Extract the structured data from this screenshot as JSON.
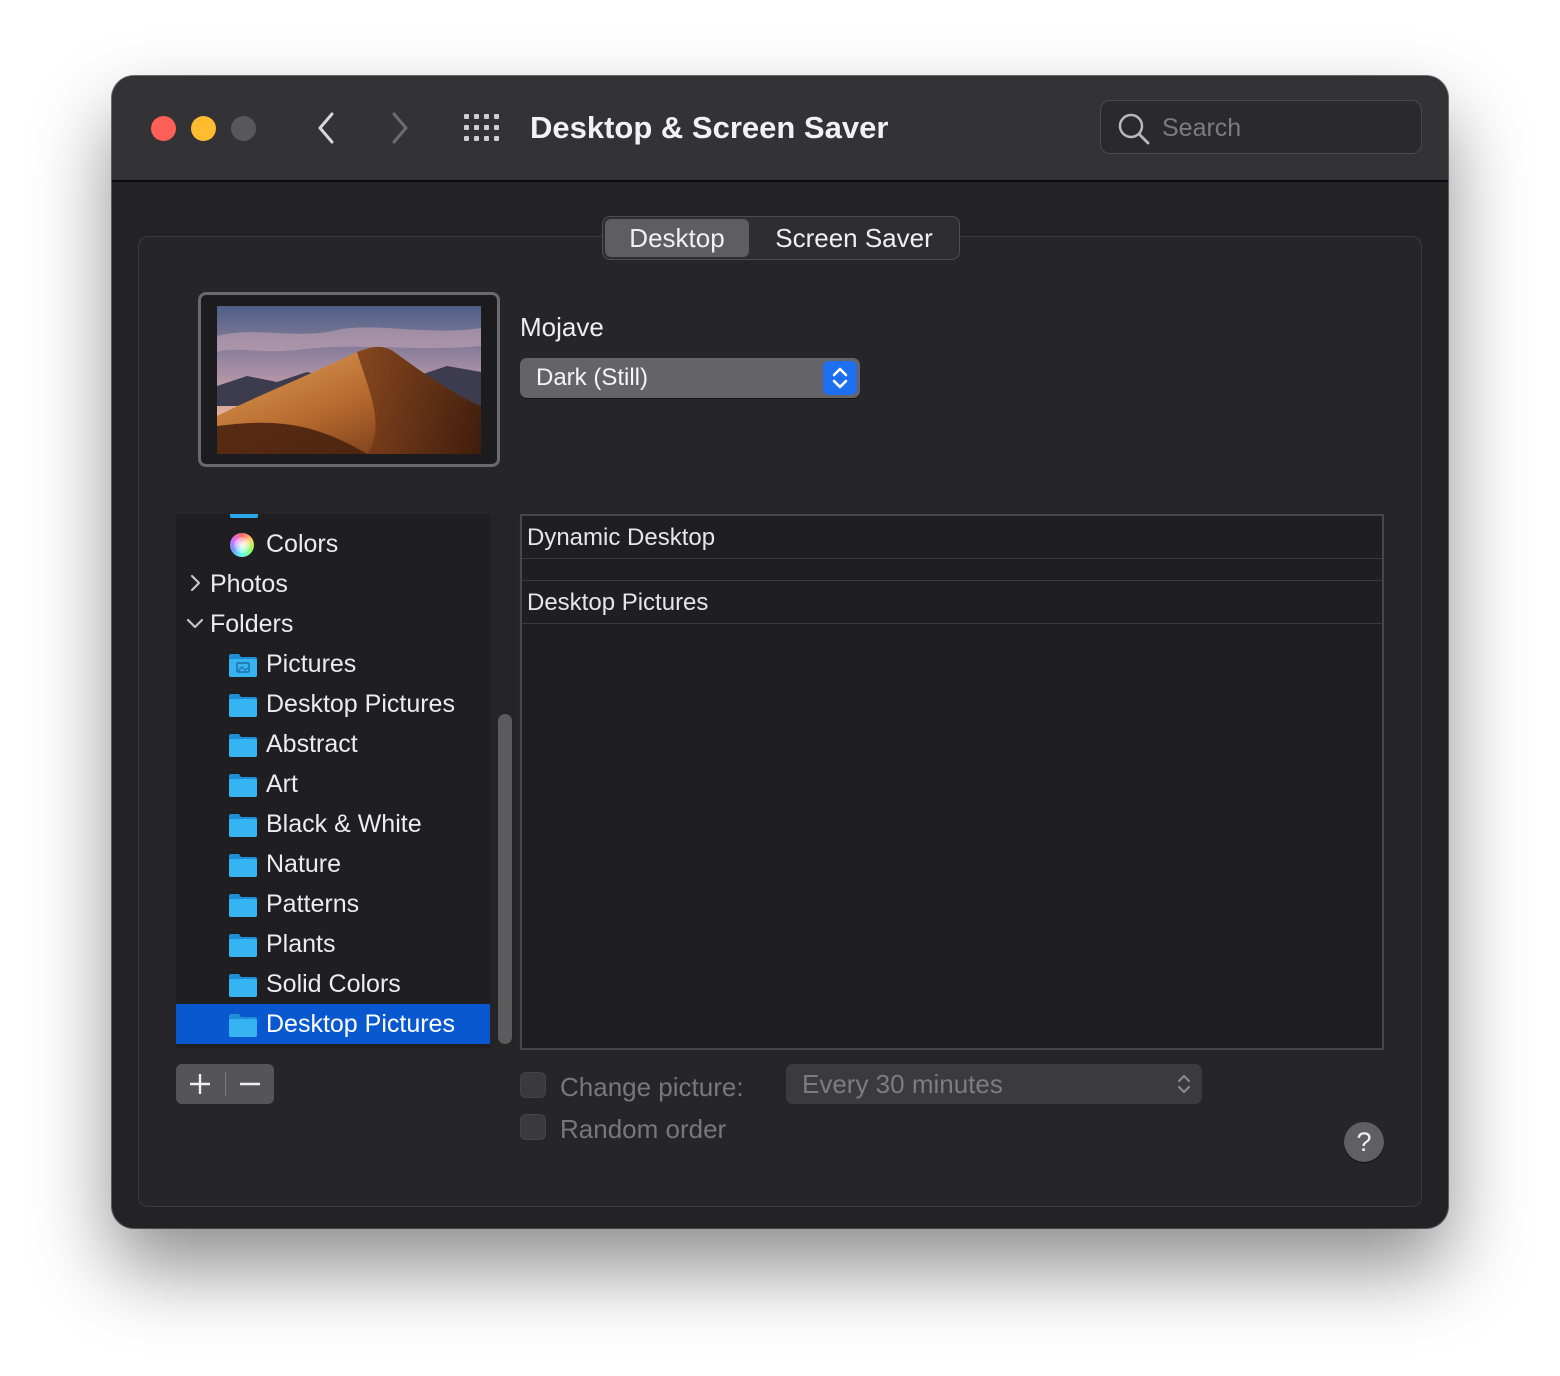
{
  "window": {
    "title": "Desktop & Screen Saver"
  },
  "toolbar": {
    "back_icon": "chevron-left-icon",
    "forward_icon": "chevron-right-icon",
    "show_all_icon": "grid-icon",
    "search_placeholder": "Search"
  },
  "tabs": [
    {
      "label": "Desktop",
      "selected": true
    },
    {
      "label": "Screen Saver",
      "selected": false
    }
  ],
  "wallpaper": {
    "name": "Mojave",
    "fit_value": "Dark (Still)"
  },
  "sidebar": {
    "items": [
      {
        "label": "Colors",
        "icon": "colors-icon"
      },
      {
        "label": "Photos",
        "icon": "chevron-right-icon"
      },
      {
        "label": "Folders",
        "icon": "chevron-down-icon"
      },
      {
        "label": "Pictures",
        "icon": "pictures-folder-icon"
      },
      {
        "label": "Desktop Pictures",
        "icon": "folder-icon"
      },
      {
        "label": "Abstract",
        "icon": "folder-icon"
      },
      {
        "label": "Art",
        "icon": "folder-icon"
      },
      {
        "label": "Black & White",
        "icon": "folder-icon"
      },
      {
        "label": "Nature",
        "icon": "folder-icon"
      },
      {
        "label": "Patterns",
        "icon": "folder-icon"
      },
      {
        "label": "Plants",
        "icon": "folder-icon"
      },
      {
        "label": "Solid Colors",
        "icon": "folder-icon"
      },
      {
        "label": "Desktop Pictures",
        "icon": "folder-icon",
        "selected": true
      }
    ]
  },
  "content": {
    "sections": [
      "Dynamic Desktop",
      "Desktop Pictures"
    ]
  },
  "controls": {
    "add_icon": "plus-icon",
    "remove_icon": "minus-icon",
    "change_picture_label": "Change picture:",
    "change_picture_checked": false,
    "interval_value": "Every 30 minutes",
    "random_order_label": "Random order",
    "random_order_checked": false,
    "help_label": "?"
  },
  "colors": {
    "accent": "#0a58d0",
    "stepper_blue": "#1e6ff0",
    "close": "#fe5f57",
    "minimize": "#febc2e",
    "folder": "#2aa8ee"
  }
}
